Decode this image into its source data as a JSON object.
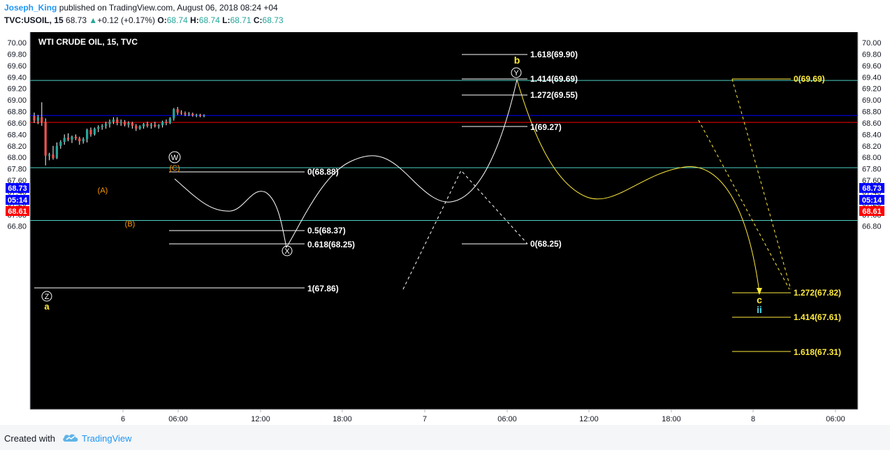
{
  "header": {
    "author": "Joseph_King",
    "published_text": "published on TradingView.com, August 06, 2018 08:24 +04",
    "symbol": "TVC:USOIL, 15",
    "last": "68.73",
    "change": "+0.12 (+0.17%)",
    "o_label": "O:",
    "o_value": "68.74",
    "h_label": "H:",
    "h_value": "68.74",
    "l_label": "L:",
    "l_value": "68.71",
    "c_label": "C:",
    "c_value": "68.73"
  },
  "footer": {
    "created_with": "Created with",
    "brand": "TradingView"
  },
  "colors": {
    "up": "#26a69a",
    "down": "#ef5350",
    "blue_line": "#0000ff",
    "red_line": "#ff0000",
    "cyan_line": "#4dd0c4",
    "yellow": "#ffeb3b",
    "plot_bg": "#000000",
    "white": "#ffffff",
    "orange": "#ff9800"
  },
  "chart_data": {
    "type": "candlestick",
    "title": "WTI CRUDE OIL, 15, TVC",
    "y_ticks": [
      "70.00",
      "69.80",
      "69.60",
      "69.40",
      "69.20",
      "69.00",
      "68.80",
      "68.60",
      "68.40",
      "68.20",
      "68.00",
      "67.80",
      "67.60",
      "67.40",
      "67.20",
      "67.00",
      "66.80"
    ],
    "ylim": [
      66.8,
      70.0
    ],
    "x_ticks": [
      "6",
      "06:00",
      "12:00",
      "18:00",
      "7",
      "06:00",
      "12:00",
      "18:00",
      "8",
      "06:00"
    ],
    "price_tags": [
      {
        "text": "68.73",
        "bg": "#0000ff",
        "price": 68.73
      },
      {
        "text": "05:14",
        "bg": "#0000ff",
        "price": 68.65
      },
      {
        "text": "68.61",
        "bg": "#ff0000",
        "price": 68.61
      }
    ],
    "hlines": [
      {
        "price": 69.34,
        "color": "#4dd0c4"
      },
      {
        "price": 68.73,
        "color": "#0000ff"
      },
      {
        "price": 68.61,
        "color": "#ff0000"
      },
      {
        "price": 67.82,
        "color": "#4dd0c4"
      },
      {
        "price": 66.9,
        "color": "#4dd0c4"
      }
    ],
    "candles": [
      {
        "o": 68.72,
        "h": 68.78,
        "l": 68.6,
        "c": 68.64
      },
      {
        "o": 68.64,
        "h": 68.74,
        "l": 68.58,
        "c": 68.7
      },
      {
        "o": 68.7,
        "h": 68.96,
        "l": 68.55,
        "c": 68.62
      },
      {
        "o": 68.62,
        "h": 68.68,
        "l": 67.86,
        "c": 68.03
      },
      {
        "o": 68.03,
        "h": 68.08,
        "l": 67.95,
        "c": 68.05
      },
      {
        "o": 68.05,
        "h": 68.2,
        "l": 67.96,
        "c": 67.99
      },
      {
        "o": 67.99,
        "h": 68.26,
        "l": 67.97,
        "c": 68.2
      },
      {
        "o": 68.2,
        "h": 68.3,
        "l": 68.15,
        "c": 68.27
      },
      {
        "o": 68.27,
        "h": 68.4,
        "l": 68.22,
        "c": 68.34
      },
      {
        "o": 68.34,
        "h": 68.42,
        "l": 68.28,
        "c": 68.31
      },
      {
        "o": 68.31,
        "h": 68.38,
        "l": 68.25,
        "c": 68.36
      },
      {
        "o": 68.36,
        "h": 68.4,
        "l": 68.3,
        "c": 68.33
      },
      {
        "o": 68.33,
        "h": 68.36,
        "l": 68.22,
        "c": 68.28
      },
      {
        "o": 68.28,
        "h": 68.35,
        "l": 68.24,
        "c": 68.32
      },
      {
        "o": 68.32,
        "h": 68.5,
        "l": 68.26,
        "c": 68.48
      },
      {
        "o": 68.48,
        "h": 68.52,
        "l": 68.36,
        "c": 68.4
      },
      {
        "o": 68.4,
        "h": 68.52,
        "l": 68.38,
        "c": 68.5
      },
      {
        "o": 68.5,
        "h": 68.56,
        "l": 68.44,
        "c": 68.53
      },
      {
        "o": 68.53,
        "h": 68.58,
        "l": 68.48,
        "c": 68.55
      },
      {
        "o": 68.55,
        "h": 68.62,
        "l": 68.5,
        "c": 68.58
      },
      {
        "o": 68.58,
        "h": 68.66,
        "l": 68.52,
        "c": 68.62
      },
      {
        "o": 68.62,
        "h": 68.7,
        "l": 68.58,
        "c": 68.66
      },
      {
        "o": 68.66,
        "h": 68.7,
        "l": 68.56,
        "c": 68.6
      },
      {
        "o": 68.6,
        "h": 68.66,
        "l": 68.55,
        "c": 68.62
      },
      {
        "o": 68.62,
        "h": 68.65,
        "l": 68.54,
        "c": 68.57
      },
      {
        "o": 68.57,
        "h": 68.63,
        "l": 68.52,
        "c": 68.6
      },
      {
        "o": 68.6,
        "h": 68.62,
        "l": 68.5,
        "c": 68.55
      },
      {
        "o": 68.55,
        "h": 68.58,
        "l": 68.46,
        "c": 68.5
      },
      {
        "o": 68.5,
        "h": 68.56,
        "l": 68.48,
        "c": 68.54
      },
      {
        "o": 68.54,
        "h": 68.6,
        "l": 68.5,
        "c": 68.58
      },
      {
        "o": 68.58,
        "h": 68.62,
        "l": 68.52,
        "c": 68.55
      },
      {
        "o": 68.55,
        "h": 68.6,
        "l": 68.5,
        "c": 68.57
      },
      {
        "o": 68.57,
        "h": 68.62,
        "l": 68.52,
        "c": 68.54
      },
      {
        "o": 68.54,
        "h": 68.58,
        "l": 68.5,
        "c": 68.56
      },
      {
        "o": 68.56,
        "h": 68.64,
        "l": 68.52,
        "c": 68.62
      },
      {
        "o": 68.62,
        "h": 68.66,
        "l": 68.56,
        "c": 68.6
      },
      {
        "o": 68.6,
        "h": 68.7,
        "l": 68.58,
        "c": 68.68
      },
      {
        "o": 68.68,
        "h": 68.86,
        "l": 68.64,
        "c": 68.84
      },
      {
        "o": 68.84,
        "h": 68.88,
        "l": 68.74,
        "c": 68.78
      },
      {
        "o": 68.78,
        "h": 68.82,
        "l": 68.74,
        "c": 68.77
      },
      {
        "o": 68.77,
        "h": 68.8,
        "l": 68.72,
        "c": 68.75
      },
      {
        "o": 68.75,
        "h": 68.79,
        "l": 68.72,
        "c": 68.76
      },
      {
        "o": 68.76,
        "h": 68.78,
        "l": 68.71,
        "c": 68.73
      },
      {
        "o": 68.73,
        "h": 68.76,
        "l": 68.7,
        "c": 68.74
      },
      {
        "o": 68.74,
        "h": 68.76,
        "l": 68.7,
        "c": 68.72
      },
      {
        "o": 68.72,
        "h": 68.75,
        "l": 68.7,
        "c": 68.73
      }
    ],
    "fib_labels": [
      {
        "text": "0(68.88)",
        "price": 68.88,
        "color": "#ffffff"
      },
      {
        "text": "0.5(68.37)",
        "price": 68.37,
        "color": "#ffffff"
      },
      {
        "text": "0.618(68.25)",
        "price": 68.25,
        "color": "#ffffff"
      },
      {
        "text": "1(67.86)",
        "price": 67.86,
        "color": "#ffffff"
      },
      {
        "text": "1.618(69.90)",
        "price": 69.9,
        "color": "#ffffff"
      },
      {
        "text": "1.414(69.69)",
        "price": 69.69,
        "color": "#ffffff"
      },
      {
        "text": "1.272(69.55)",
        "price": 69.55,
        "color": "#ffffff"
      },
      {
        "text": "1(69.27)",
        "price": 69.27,
        "color": "#ffffff"
      },
      {
        "text": "0(68.25)",
        "price": 68.25,
        "color": "#ffffff"
      },
      {
        "text": "0(69.69)",
        "price": 69.69,
        "color": "#ffeb3b"
      },
      {
        "text": "1.272(67.82)",
        "price": 67.82,
        "color": "#ffeb3b"
      },
      {
        "text": "1.414(67.61)",
        "price": 67.61,
        "color": "#ffeb3b"
      },
      {
        "text": "1.618(67.31)",
        "price": 67.31,
        "color": "#ffeb3b"
      }
    ],
    "wave_labels": [
      {
        "text": "W",
        "kind": "circle",
        "color": "#ffffff"
      },
      {
        "text": "(C)",
        "kind": "text",
        "color": "#ff9800"
      },
      {
        "text": "(A)",
        "kind": "text",
        "color": "#ff9800"
      },
      {
        "text": "(B)",
        "kind": "text",
        "color": "#ff9800"
      },
      {
        "text": "Z",
        "kind": "circle",
        "color": "#ffffff"
      },
      {
        "text": "a",
        "kind": "text",
        "color": "#ffeb3b"
      },
      {
        "text": "X",
        "kind": "circle",
        "color": "#ffffff"
      },
      {
        "text": "Y",
        "kind": "circle",
        "color": "#ffffff"
      },
      {
        "text": "b",
        "kind": "text",
        "color": "#ffeb3b"
      },
      {
        "text": "c",
        "kind": "text",
        "color": "#ffeb3b"
      },
      {
        "text": "ii",
        "kind": "text",
        "color": "#4dd0e1"
      }
    ]
  }
}
